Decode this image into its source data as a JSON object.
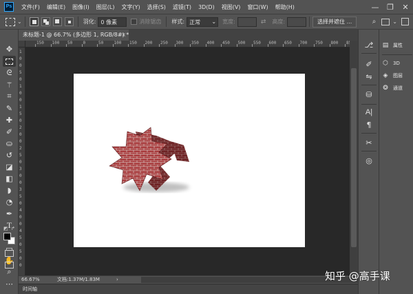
{
  "menu": [
    "文件(F)",
    "编辑(E)",
    "图像(I)",
    "图层(L)",
    "文字(Y)",
    "选择(S)",
    "滤镜(T)",
    "3D(D)",
    "视图(V)",
    "窗口(W)",
    "帮助(H)"
  ],
  "app_logo": "Ps",
  "window_controls": {
    "minimize": "—",
    "restore": "❐",
    "close": "✕"
  },
  "options": {
    "feather_label": "羽化:",
    "feather_value": "0 像素",
    "antialias_label": "消除锯齿",
    "style_label": "样式:",
    "style_value": "正常",
    "width_label": "宽度:",
    "height_label": "高度:",
    "select_mask_button": "选择并遮住 ..."
  },
  "document_tab": {
    "title": "未标题-1 @ 66.7% (多边形 1, RGB/8#) *",
    "close": "×"
  },
  "ruler_top": [
    "150",
    "100",
    "50",
    "0",
    "50",
    "100",
    "150",
    "200",
    "250",
    "300",
    "350",
    "400",
    "450",
    "500",
    "550",
    "600",
    "650",
    "700",
    "750",
    "800",
    "850"
  ],
  "ruler_left": [
    "1",
    "0",
    "0",
    "5",
    "0",
    "1",
    "0",
    "0",
    "1",
    "5",
    "0",
    "2",
    "0",
    "0",
    "2",
    "5",
    "0",
    "3",
    "0",
    "0",
    "3",
    "5",
    "0",
    "4",
    "0",
    "0",
    "4",
    "5",
    "0",
    "5",
    "0",
    "0"
  ],
  "status": {
    "zoom": "66.67%",
    "doc_info": "文档:1.37M/1.83M",
    "arrow": "›"
  },
  "timeline_label": "时间轴",
  "right_panel": {
    "properties": "属性",
    "threed": "3D",
    "layers": "图层",
    "channels": "通道"
  },
  "watermark": "知乎 @高手课",
  "colors": {
    "brick": "#a83a3c",
    "brick_dark": "#6e2224",
    "mortar": "#d9c8c4",
    "canvas_bg": "#282828",
    "panel": "#535353"
  }
}
